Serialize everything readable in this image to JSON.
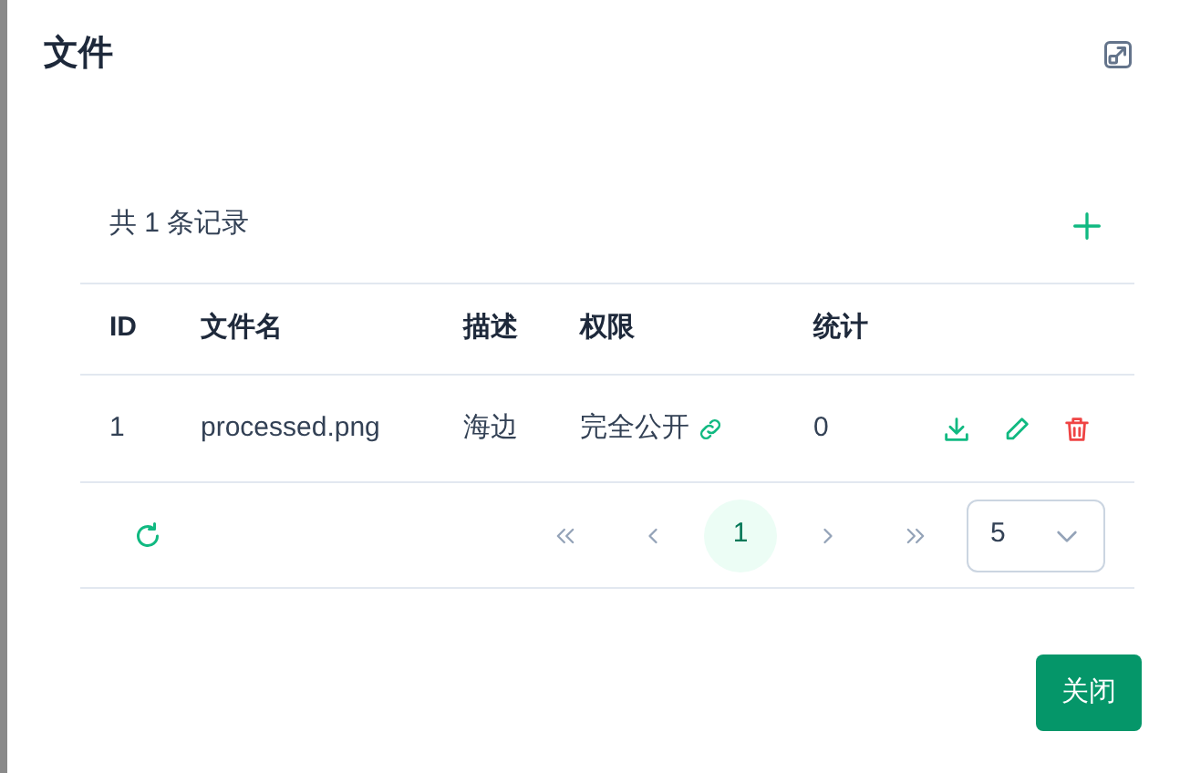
{
  "dialog": {
    "title": "文件"
  },
  "summary": "共 1 条记录",
  "table": {
    "columns": [
      "ID",
      "文件名",
      "描述",
      "权限",
      "统计"
    ],
    "rows": [
      {
        "id": "1",
        "filename": "processed.png",
        "description": "海边",
        "permission": "完全公开",
        "count": "0"
      }
    ]
  },
  "pagination": {
    "pages": [
      {
        "label": "1",
        "selected": true
      }
    ],
    "page_size": "5"
  },
  "buttons": [
    {
      "label": "关闭"
    }
  ]
}
